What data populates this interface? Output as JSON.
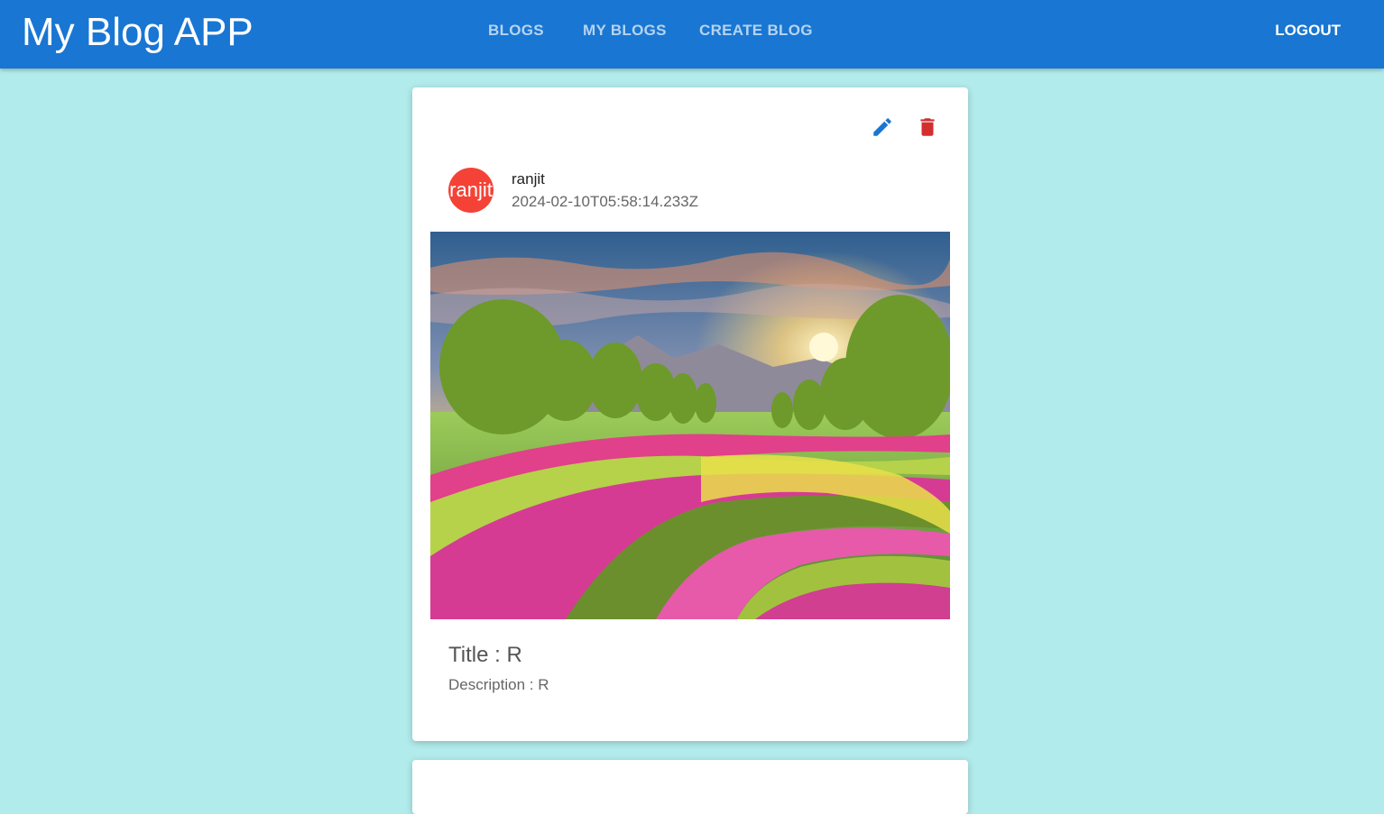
{
  "app": {
    "title": "My Blog APP"
  },
  "nav": {
    "tabs": [
      {
        "label": "BLOGS"
      },
      {
        "label": "MY BLOGS"
      },
      {
        "label": "CREATE BLOG"
      }
    ],
    "logout_label": "LOGOUT"
  },
  "post": {
    "avatar_text": "ranjit",
    "author": "ranjit",
    "date": "2024-02-10T05:58:14.233Z",
    "image_alt": "Landscape of curving pink and yellow flower fields with trees and mountains at sunset",
    "title": "Title : R",
    "description": "Description : R",
    "actions": {
      "edit_icon": "pencil-icon",
      "delete_icon": "trash-icon"
    }
  },
  "colors": {
    "appbar": "#1976d2",
    "background": "#b2ebeb",
    "edit": "#1976d2",
    "delete": "#d32f2f",
    "avatar": "#f44336"
  }
}
